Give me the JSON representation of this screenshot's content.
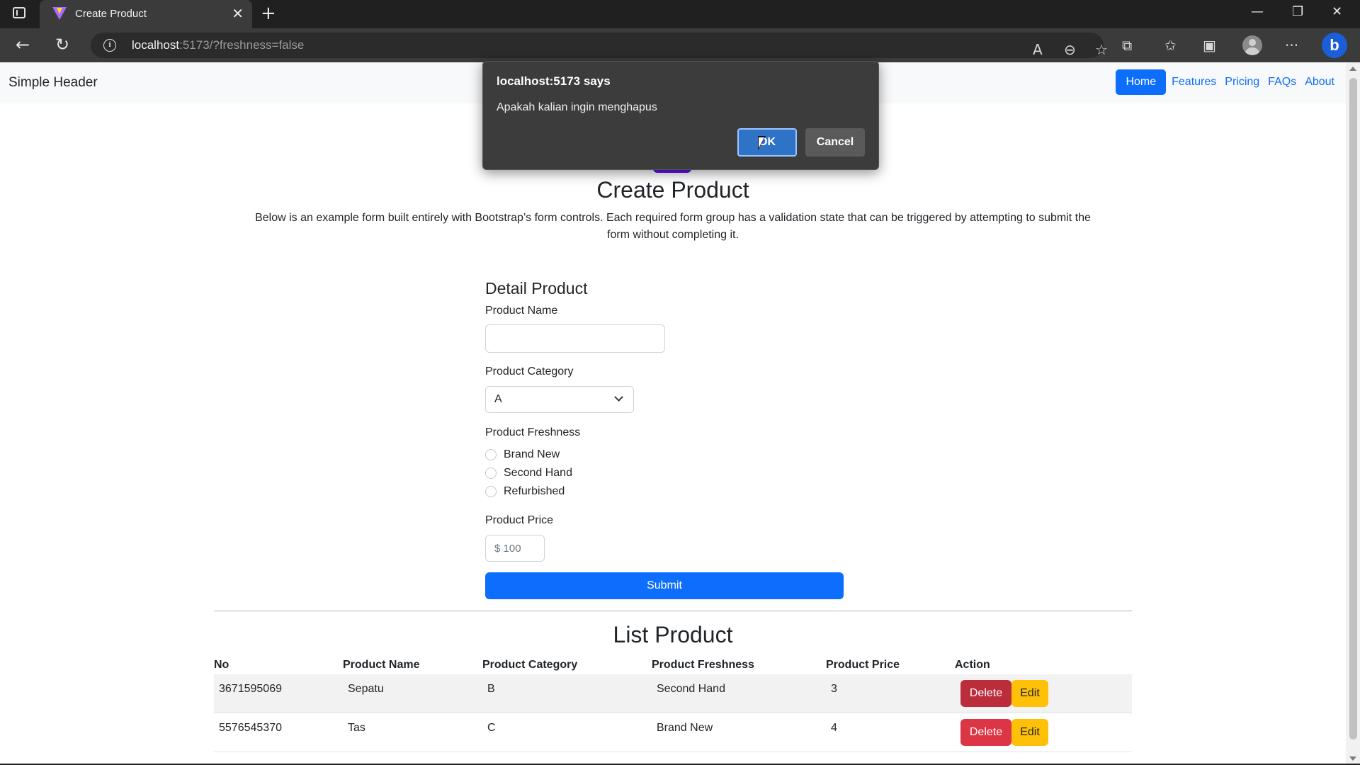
{
  "browser": {
    "tab_title": "Create Product",
    "url_host": "localhost",
    "url_rest": ":5173/?freshness=false"
  },
  "header": {
    "brand": "Simple Header",
    "nav": [
      "Home",
      "Features",
      "Pricing",
      "FAQs",
      "About"
    ],
    "active_nav": "Home"
  },
  "hero": {
    "title": "Create Product",
    "lead": "Below is an example form built entirely with Bootstrap’s form controls. Each required form group has a validation state that can be triggered by attempting to submit the form without completing it."
  },
  "form": {
    "section_title": "Detail Product",
    "name_label": "Product Name",
    "name_value": "",
    "category_label": "Product Category",
    "category_value": "A",
    "freshness_label": "Product Freshness",
    "freshness_options": [
      "Brand New",
      "Second Hand",
      "Refurbished"
    ],
    "price_label": "Product Price",
    "price_placeholder": "$ 100",
    "submit_label": "Submit"
  },
  "list": {
    "title": "List Product",
    "columns": [
      "No",
      "Product Name",
      "Product Category",
      "Product Freshness",
      "Product Price",
      "Action"
    ],
    "rows": [
      {
        "no": "3671595069",
        "name": "Sepatu",
        "category": "B",
        "freshness": "Second Hand",
        "price": "3"
      },
      {
        "no": "5576545370",
        "name": "Tas",
        "category": "C",
        "freshness": "Brand New",
        "price": "4"
      }
    ],
    "delete_label": "Delete",
    "edit_label": "Edit"
  },
  "dialog": {
    "title": "localhost:5173 says",
    "message": "Apakah kalian ingin menghapus",
    "ok_label": "OK",
    "cancel_label": "Cancel"
  },
  "colors": {
    "primary": "#0d6efd",
    "danger": "#dc3545",
    "warning": "#ffc107",
    "dialog_bg": "#3c3c3c"
  }
}
